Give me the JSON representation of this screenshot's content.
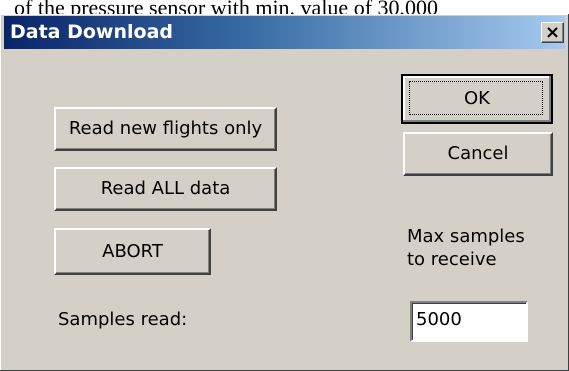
{
  "background": {
    "visible_text_fragment": "of the pressure sensor with min. value of 30,000"
  },
  "dialog": {
    "title": "Data Download",
    "close_glyph": "×",
    "buttons": {
      "read_new": "Read new flights only",
      "read_all": "Read ALL data",
      "abort": "ABORT",
      "ok": "OK",
      "cancel": "Cancel"
    },
    "labels": {
      "samples_read": "Samples read:",
      "max_samples_line1": "Max samples",
      "max_samples_line2": "to receive"
    },
    "max_samples_value": "5000"
  },
  "colors": {
    "dialog_face": "#d4d0c8",
    "title_gradient_start": "#0a246a",
    "title_gradient_end": "#a6caf0"
  }
}
